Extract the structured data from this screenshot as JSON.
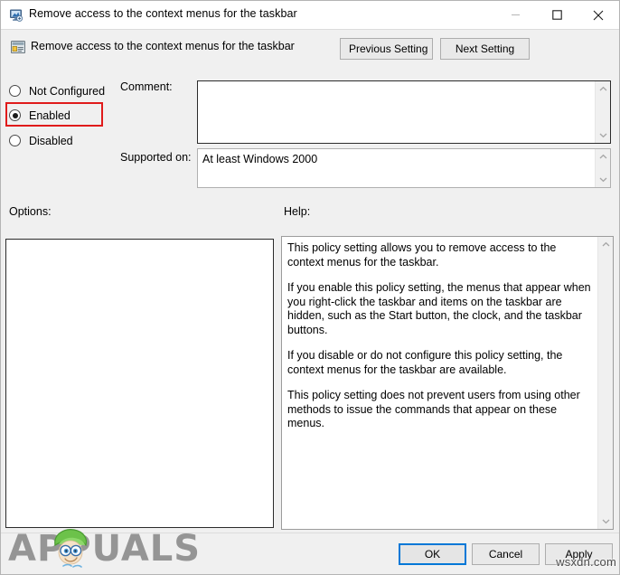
{
  "window": {
    "title": "Remove access to the context menus for the taskbar",
    "titlebar_icon": "computer-monitor-icon",
    "controls": {
      "minimize": "minimize-icon",
      "maximize": "maximize-icon",
      "close": "close-icon"
    }
  },
  "header": {
    "icon": "policy-setting-icon",
    "title": "Remove access to the context menus for the taskbar",
    "previous_setting_label": "Previous Setting",
    "next_setting_label": "Next Setting"
  },
  "state_options": [
    {
      "id": "not-configured",
      "label": "Not Configured",
      "selected": false
    },
    {
      "id": "enabled",
      "label": "Enabled",
      "selected": true
    },
    {
      "id": "disabled",
      "label": "Disabled",
      "selected": false
    }
  ],
  "highlight": {
    "target": "enabled",
    "color": "#e01b1b"
  },
  "comment": {
    "label": "Comment:",
    "value": "",
    "placeholder": ""
  },
  "supported_on": {
    "label": "Supported on:",
    "value": "At least Windows 2000"
  },
  "options": {
    "label": "Options:",
    "items": []
  },
  "help": {
    "label": "Help:",
    "paragraphs": [
      "This policy setting allows you to remove access to the context menus for the taskbar.",
      "If you enable this policy setting, the menus that appear when you right-click the taskbar and items on the taskbar are hidden, such as the Start button, the clock, and the taskbar buttons.",
      "If you disable or do not configure this policy setting, the context menus for the taskbar are available.",
      "This policy setting does not prevent users from using other methods to issue the commands that appear on these menus."
    ]
  },
  "footer": {
    "ok_label": "OK",
    "cancel_label": "Cancel",
    "apply_label": "Apply",
    "focused_button": "OK",
    "focus_color": "#0078d7"
  },
  "watermarks": {
    "brand": "APPUALS",
    "site": "wsxdn.com"
  },
  "scrollbars": {
    "up_arrow": "chevron-up-icon",
    "down_arrow": "chevron-down-icon"
  }
}
